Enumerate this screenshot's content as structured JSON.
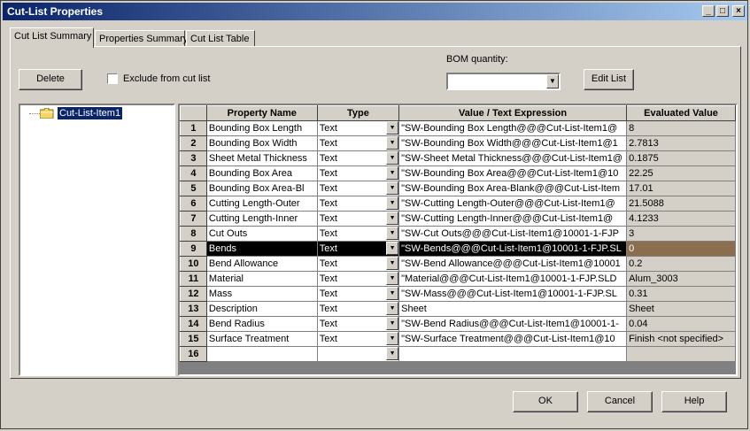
{
  "window": {
    "title": "Cut-List Properties",
    "min": "_",
    "max": "□",
    "close": "×"
  },
  "tabs": [
    "Cut List Summary",
    "Properties Summary",
    "Cut List Table"
  ],
  "toolbar": {
    "delete_label": "Delete",
    "exclude_label": "Exclude from cut list",
    "bom_label": "BOM quantity:",
    "bom_value": "",
    "edit_list_label": "Edit List"
  },
  "tree": {
    "item": "Cut-List-Item1"
  },
  "table": {
    "headers": [
      "Property Name",
      "Type",
      "Value / Text Expression",
      "Evaluated Value"
    ],
    "selected_row": 9,
    "rows": [
      {
        "n": "1",
        "name": "Bounding Box Length",
        "type": "Text",
        "value": "\"SW-Bounding Box Length@@@Cut-List-Item1@",
        "eval": "8"
      },
      {
        "n": "2",
        "name": "Bounding Box Width",
        "type": "Text",
        "value": "\"SW-Bounding Box Width@@@Cut-List-Item1@1",
        "eval": "2.7813"
      },
      {
        "n": "3",
        "name": "Sheet Metal Thickness",
        "type": "Text",
        "value": "\"SW-Sheet Metal Thickness@@@Cut-List-Item1@",
        "eval": "0.1875"
      },
      {
        "n": "4",
        "name": "Bounding Box Area",
        "type": "Text",
        "value": "\"SW-Bounding Box Area@@@Cut-List-Item1@10",
        "eval": "22.25"
      },
      {
        "n": "5",
        "name": "Bounding Box Area-Bl",
        "type": "Text",
        "value": "\"SW-Bounding Box Area-Blank@@@Cut-List-Item",
        "eval": "17.01"
      },
      {
        "n": "6",
        "name": "Cutting Length-Outer",
        "type": "Text",
        "value": "\"SW-Cutting Length-Outer@@@Cut-List-Item1@",
        "eval": "21.5088"
      },
      {
        "n": "7",
        "name": "Cutting Length-Inner",
        "type": "Text",
        "value": "\"SW-Cutting Length-Inner@@@Cut-List-Item1@",
        "eval": "4.1233"
      },
      {
        "n": "8",
        "name": "Cut Outs",
        "type": "Text",
        "value": "\"SW-Cut Outs@@@Cut-List-Item1@10001-1-FJP",
        "eval": "3"
      },
      {
        "n": "9",
        "name": "Bends",
        "type": "Text",
        "value": "\"SW-Bends@@@Cut-List-Item1@10001-1-FJP.SL",
        "eval": "0"
      },
      {
        "n": "10",
        "name": "Bend Allowance",
        "type": "Text",
        "value": "\"SW-Bend Allowance@@@Cut-List-Item1@10001",
        "eval": "0.2"
      },
      {
        "n": "11",
        "name": "Material",
        "type": "Text",
        "value": "\"Material@@@Cut-List-Item1@10001-1-FJP.SLD",
        "eval": "Alum_3003"
      },
      {
        "n": "12",
        "name": "Mass",
        "type": "Text",
        "value": "\"SW-Mass@@@Cut-List-Item1@10001-1-FJP.SL",
        "eval": "0.31"
      },
      {
        "n": "13",
        "name": "Description",
        "type": "Text",
        "value": "Sheet",
        "eval": "Sheet"
      },
      {
        "n": "14",
        "name": "Bend Radius",
        "type": "Text",
        "value": "\"SW-Bend Radius@@@Cut-List-Item1@10001-1-",
        "eval": "0.04"
      },
      {
        "n": "15",
        "name": "Surface Treatment",
        "type": "Text",
        "value": "\"SW-Surface Treatment@@@Cut-List-Item1@10",
        "eval": "Finish <not specified>"
      },
      {
        "n": "16",
        "name": "",
        "type": "",
        "value": "",
        "eval": ""
      }
    ]
  },
  "footer": {
    "ok_label": "OK",
    "cancel_label": "Cancel",
    "help_label": "Help"
  }
}
